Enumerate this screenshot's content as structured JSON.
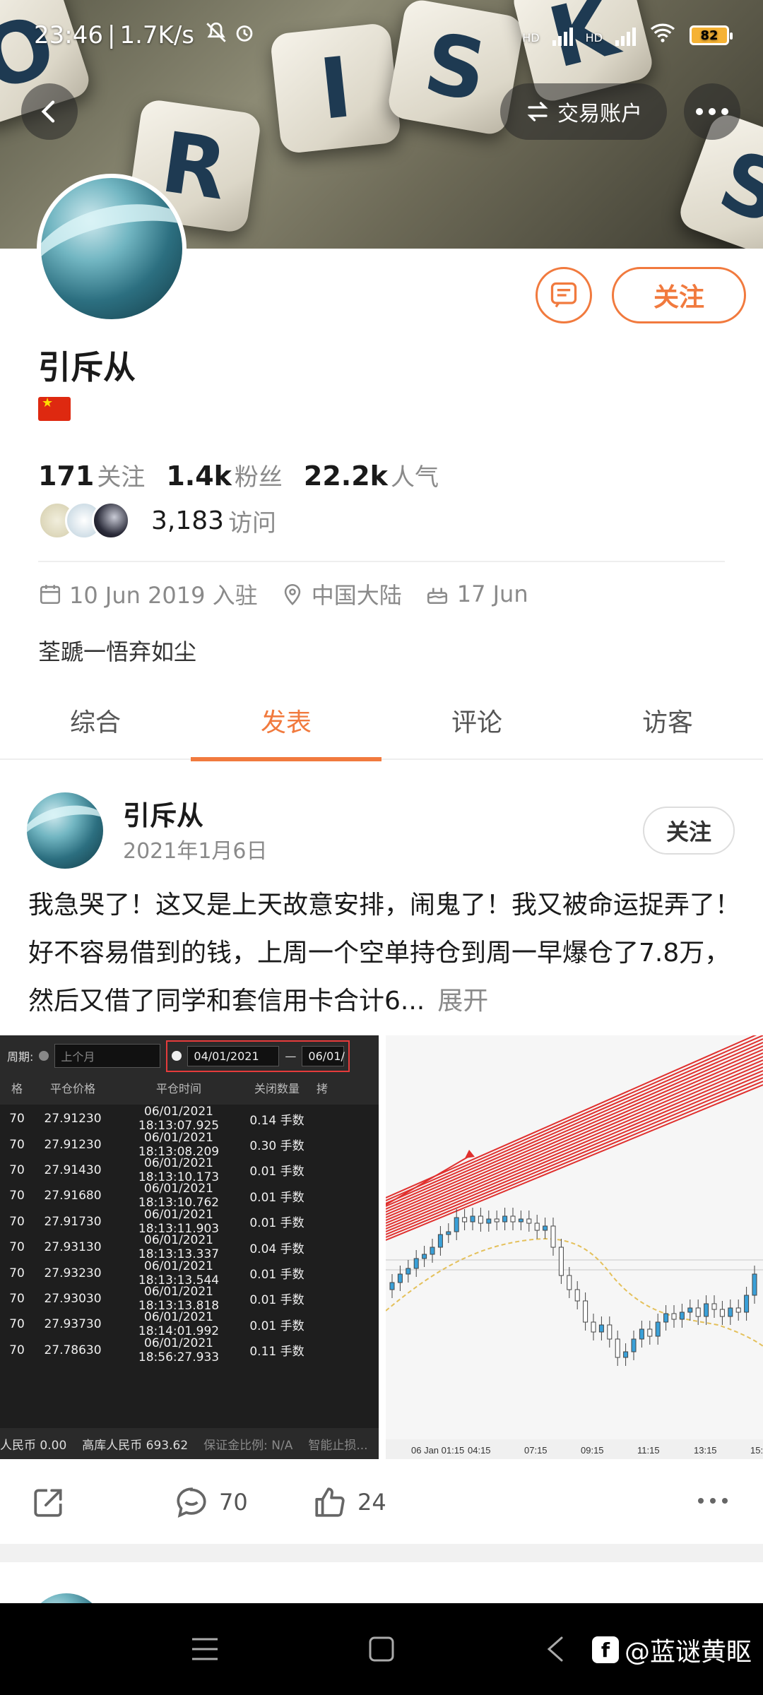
{
  "status_bar": {
    "time": "23:46",
    "speed": "1.7K/s",
    "network_1": "HD",
    "network_2": "HD",
    "battery": "82"
  },
  "banner": {
    "dice_letters": [
      "O",
      "R",
      "I",
      "S",
      "K",
      "S"
    ],
    "trade_account_label": "交易账户"
  },
  "profile": {
    "username": "引斥从",
    "follow_label": "关注",
    "stats": [
      {
        "num": "171",
        "label": "关注"
      },
      {
        "num": "1.4k",
        "label": "粉丝"
      },
      {
        "num": "22.2k",
        "label": "人气"
      }
    ],
    "visits_num": "3,183",
    "visits_label": "访问",
    "joined": "10 Jun 2019 入驻",
    "location": "中国大陆",
    "birthday": "17 Jun",
    "bio": "荃蹏一悟弃如尘"
  },
  "tabs": [
    {
      "label": "综合",
      "active": false
    },
    {
      "label": "发表",
      "active": true
    },
    {
      "label": "评论",
      "active": false
    },
    {
      "label": "访客",
      "active": false
    }
  ],
  "post": {
    "author": "引斥从",
    "date": "2021年1月6日",
    "follow_label": "关注",
    "text": "我急哭了！这又是上天故意安排，闹鬼了！我又被命运捉弄了！好不容易借到的钱，上周一个空单持仓到周一早爆仓了7.8万，然后又借了同学和套信用卡合计6...",
    "expand_label": "展开",
    "comments": "70",
    "likes": "24",
    "table_image": {
      "toolbar_period": "周期:",
      "toolbar_last_month": "上个月",
      "date_from": "04/01/2021",
      "date_to_partial": "06/01/",
      "columns": [
        "格",
        "平仓价格",
        "平仓时间",
        "关闭数量",
        "拷"
      ],
      "rows": [
        [
          "70",
          "27.91230",
          "06/01/2021 18:13:07.925",
          "0.14 手数"
        ],
        [
          "70",
          "27.91230",
          "06/01/2021 18:13:08.209",
          "0.30 手数"
        ],
        [
          "70",
          "27.91430",
          "06/01/2021 18:13:10.173",
          "0.01 手数"
        ],
        [
          "70",
          "27.91680",
          "06/01/2021 18:13:10.762",
          "0.01 手数"
        ],
        [
          "70",
          "27.91730",
          "06/01/2021 18:13:11.903",
          "0.01 手数"
        ],
        [
          "70",
          "27.93130",
          "06/01/2021 18:13:13.337",
          "0.04 手数"
        ],
        [
          "70",
          "27.93230",
          "06/01/2021 18:13:13.544",
          "0.01 手数"
        ],
        [
          "70",
          "27.93030",
          "06/01/2021 18:13:13.818",
          "0.01 手数"
        ],
        [
          "70",
          "27.93730",
          "06/01/2021 18:14:01.992",
          "0.01 手数"
        ],
        [
          "70",
          "27.78630",
          "06/01/2021 18:56:27.933",
          "0.11 手数"
        ]
      ],
      "footer": [
        "人民币 0.00",
        "高库人民币 693.62",
        "保证金比例: N/A",
        "智能止损..."
      ]
    },
    "chart_image": {
      "x_ticks": [
        "06 Jan 01:15",
        "04:15",
        "07:15",
        "09:15",
        "11:15",
        "13:15",
        "15:"
      ]
    }
  },
  "navbar": {
    "watermark": "@蓝谜黄眍",
    "logo_letter": "f"
  },
  "colors": {
    "accent": "#f17a3e",
    "text_primary": "#1a1a1a",
    "text_secondary": "#8a8a8a"
  }
}
